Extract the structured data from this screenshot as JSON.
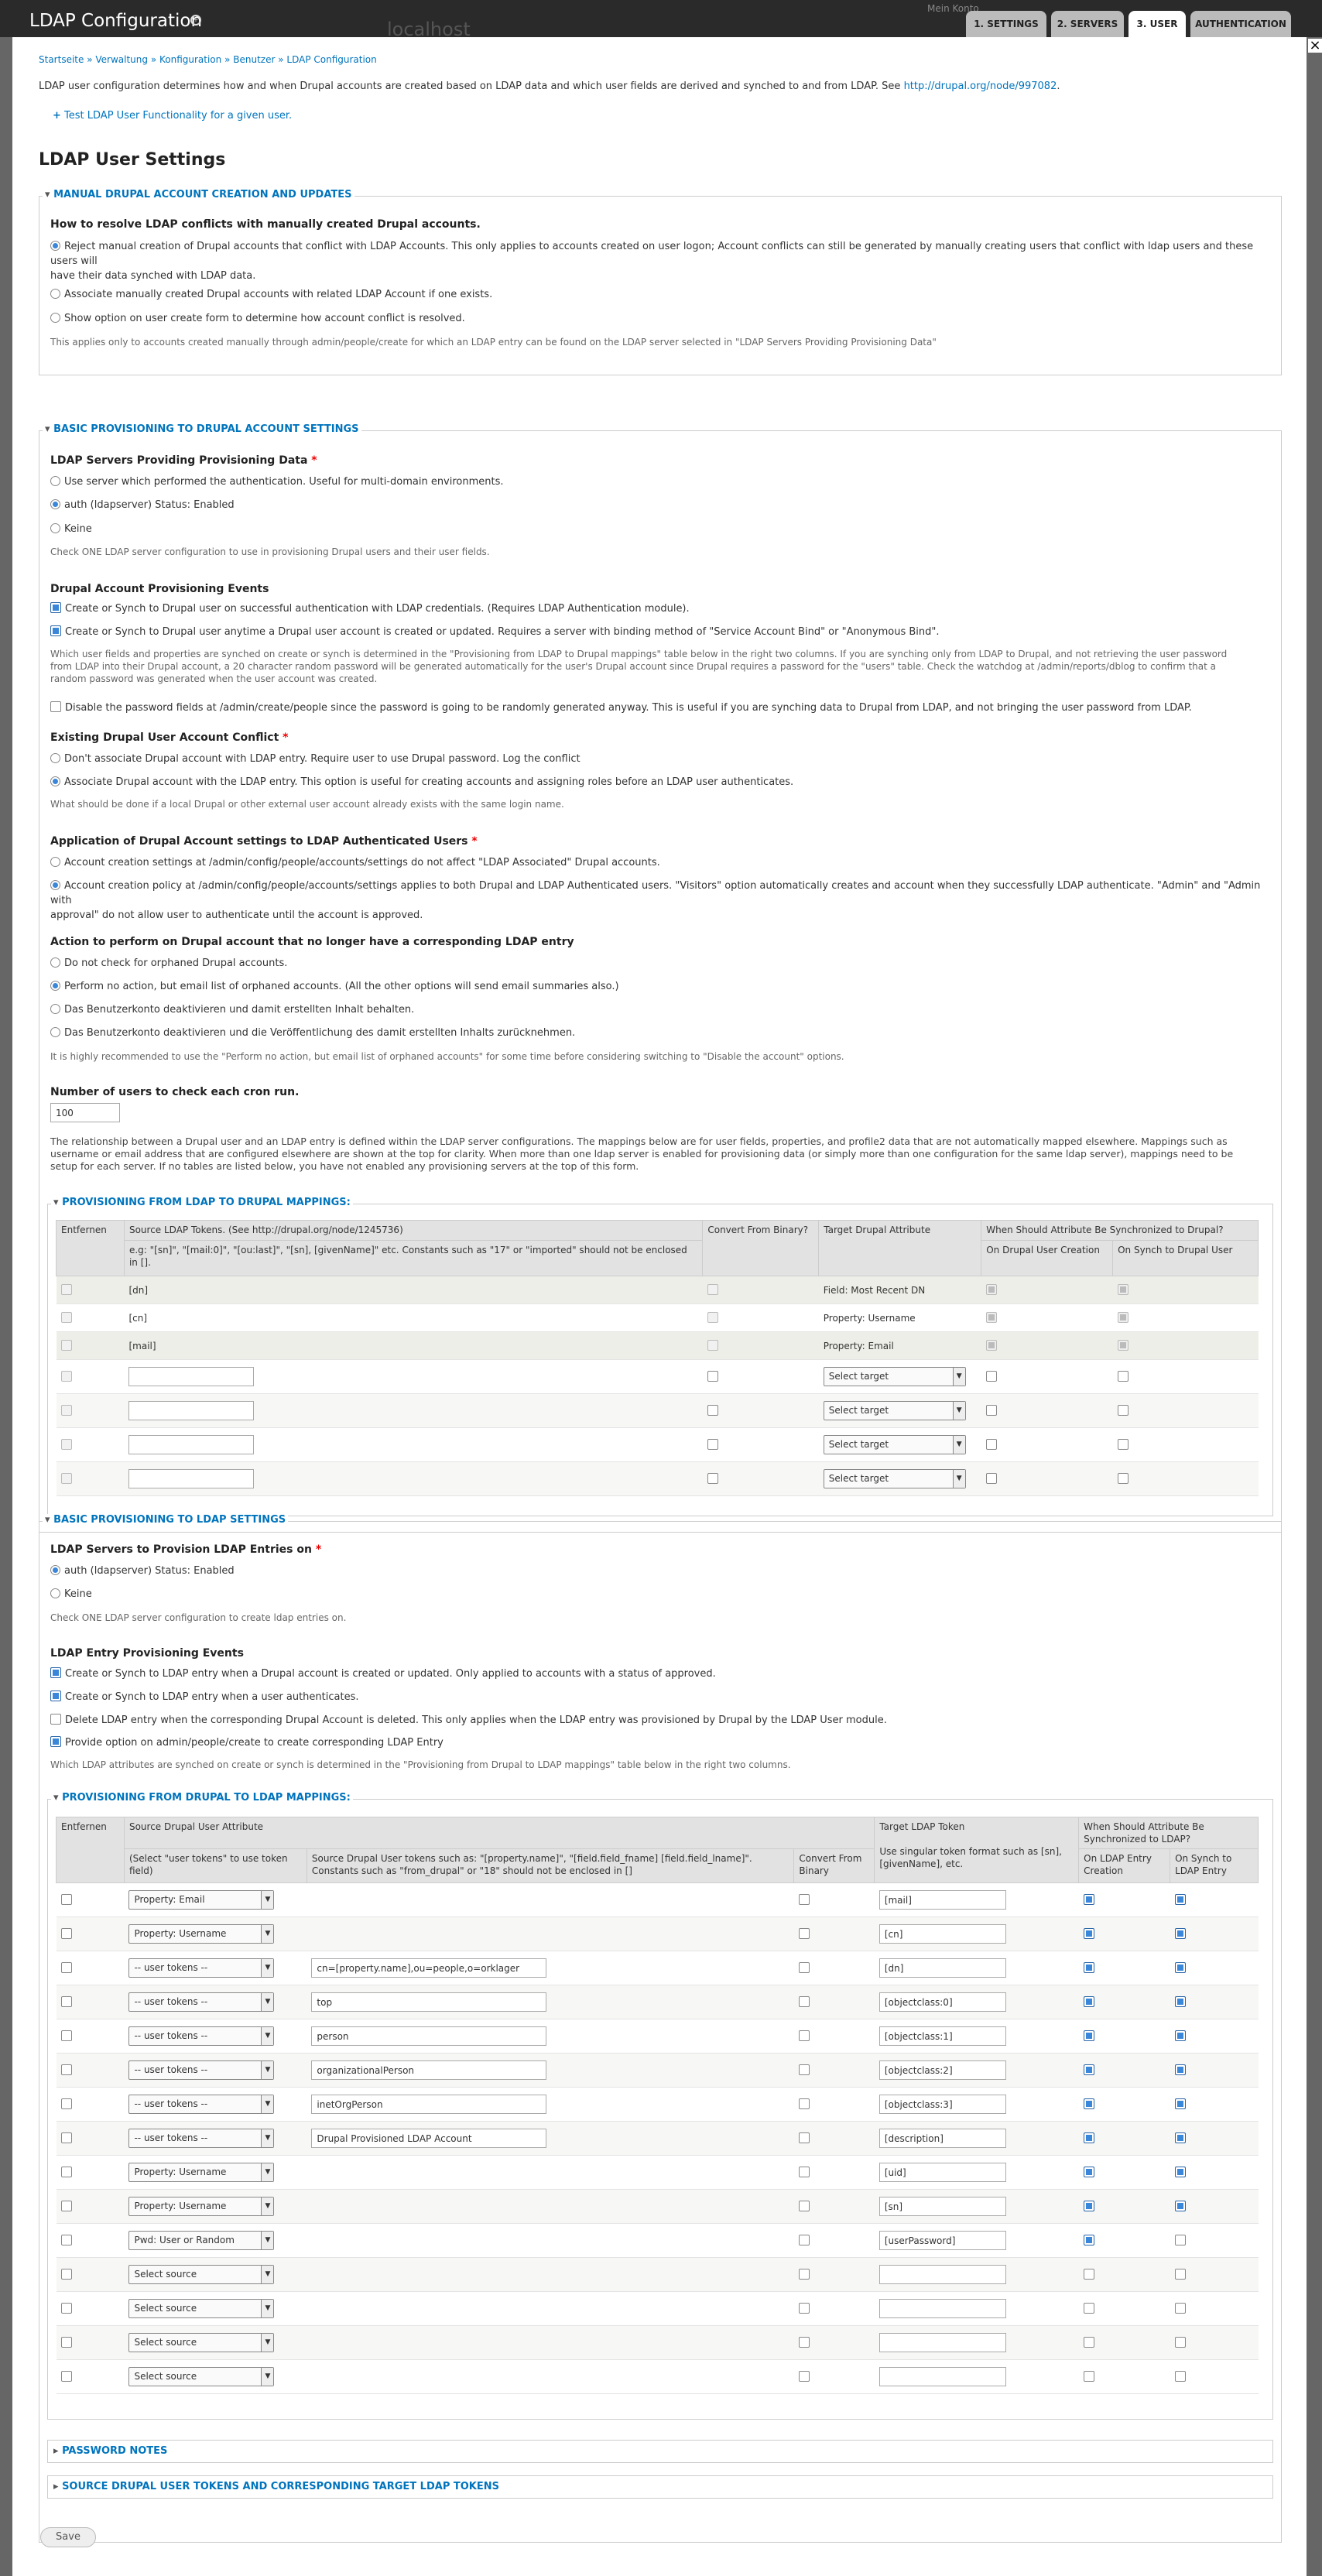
{
  "header": {
    "title": "LDAP Configuration",
    "site": "localhost",
    "user_link": "Mein Konto"
  },
  "tabs": [
    "1. SETTINGS",
    "2. SERVERS",
    "3. USER",
    "AUTHENTICATION"
  ],
  "breadcrumb": [
    "Startseite",
    "Verwaltung",
    "Konfiguration",
    "Benutzer",
    "LDAP Configuration"
  ],
  "intro_text": "LDAP user configuration determines how and when Drupal accounts are created based on LDAP data and which user fields are derived and synched to and from LDAP. See",
  "intro_link": "http://drupal.org/node/997082",
  "test_link": "Test LDAP User Functionality for a given user.",
  "page_title": "LDAP User Settings",
  "manual": {
    "legend": "MANUAL DRUPAL ACCOUNT CREATION AND UPDATES",
    "question": "How to resolve LDAP conflicts with manually created Drupal accounts.",
    "options": [
      "Reject manual creation of Drupal accounts that conflict with LDAP Accounts. This only applies to accounts created on user logon; Account conflicts can still be generated by manually creating users that conflict with ldap users and these users will",
      "have their data synched with LDAP data.",
      "Associate manually created Drupal accounts with related LDAP Account if one exists.",
      "Show option on user create form to determine how account conflict is resolved."
    ],
    "desc": "This applies only to accounts created manually through admin/people/create for which an LDAP entry can be found on the LDAP server selected in \"LDAP Servers Providing Provisioning Data\""
  },
  "basic_drupal": {
    "legend": "BASIC PROVISIONING TO DRUPAL ACCOUNT SETTINGS",
    "servers_label": "LDAP Servers Providing Provisioning Data",
    "server_opts": [
      "Use server which performed the authentication. Useful for multi-domain environments.",
      "auth (ldapserver) Status: Enabled",
      "Keine"
    ],
    "server_desc": "Check ONE LDAP server configuration to use in provisioning Drupal users and their user fields.",
    "events_label": "Drupal Account Provisioning Events",
    "event_opts": [
      "Create or Synch to Drupal user on successful authentication with LDAP credentials. (Requires LDAP Authentication module).",
      "Create or Synch to Drupal user anytime a Drupal user account is created or updated. Requires a server with binding method of \"Service Account Bind\" or \"Anonymous Bind\"."
    ],
    "events_desc": [
      "Which user fields and properties are synched on create or synch is determined in the \"Provisioning from LDAP to Drupal mappings\" table below in the right two columns. If you are synching only from LDAP to Drupal, and not retrieving the user password",
      "from LDAP into their Drupal account, a 20 character random password will be generated automatically for the user's Drupal account since Drupal requires a password for the \"users\" table. Check the watchdog at /admin/reports/dblog to confirm that a",
      "random password was generated when the user account was created."
    ],
    "disable_pw": "Disable the password fields at /admin/create/people since the password is going to be randomly generated anyway. This is useful if you are synching data to Drupal from LDAP, and not bringing the user password from LDAP.",
    "conflict_label": "Existing Drupal User Account Conflict",
    "conflict_opts": [
      "Don't associate Drupal account with LDAP entry. Require user to use Drupal password. Log the conflict",
      "Associate Drupal account with the LDAP entry. This option is useful for creating accounts and assigning roles before an LDAP user authenticates."
    ],
    "conflict_desc": "What should be done if a local Drupal or other external user account already exists with the same login name.",
    "app_label": "Application of Drupal Account settings to LDAP Authenticated Users",
    "app_opts": [
      "Account creation settings at /admin/config/people/accounts/settings do not affect \"LDAP Associated\" Drupal accounts.",
      "Account creation policy at /admin/config/people/accounts/settings applies to both Drupal and LDAP Authenticated users. \"Visitors\" option automatically creates and account when they successfully LDAP authenticate. \"Admin\" and \"Admin with",
      "approval\" do not allow user to authenticate until the account is approved."
    ],
    "orphan_label": "Action to perform on Drupal account that no longer have a corresponding LDAP entry",
    "orphan_opts": [
      "Do not check for orphaned Drupal accounts.",
      "Perform no action, but email list of orphaned accounts. (All the other options will send email summaries also.)",
      "Das Benutzerkonto deaktivieren und damit erstellten Inhalt behalten.",
      "Das Benutzerkonto deaktivieren und die Veröffentlichung des damit erstellten Inhalts zurücknehmen."
    ],
    "orphan_desc": "It is highly recommended to use the \"Perform no action, but email list of orphaned accounts\" for some time before considering switching to \"Disable the account\" options.",
    "cron_label": "Number of users to check each cron run.",
    "cron_value": "100",
    "mapping_desc": [
      "The relationship between a Drupal user and an LDAP entry is defined within the LDAP server configurations. The mappings below are for user fields, properties, and profile2 data that are not automatically mapped elsewhere. Mappings such as",
      "username or email address that are configured elsewhere are shown at the top for clarity. When more than one ldap server is enabled for provisioning data (or simply more than one configuration for the same ldap server), mappings need to be",
      "setup for each server. If no tables are listed below, you have not enabled any provisioning servers at the top of this form."
    ]
  },
  "ldap_to_drupal": {
    "legend": "PROVISIONING FROM LDAP TO DRUPAL MAPPINGS:",
    "headers": [
      "Entfernen",
      "Source LDAP Tokens. (See http://drupal.org/node/1245736)",
      "Convert From Binary?",
      "Target Drupal Attribute",
      "When Should Attribute Be Synchronized to Drupal?"
    ],
    "subheaders": [
      "e.g: \"[sn]\", \"[mail:0]\", \"[ou:last]\", \"[sn], [givenName]\" etc. Constants such as \"17\" or \"imported\" should not be enclosed",
      "in [].",
      "On Drupal User Creation",
      "On Synch to Drupal User"
    ],
    "fixed_rows": [
      {
        "source": "[dn]",
        "target": "Field: Most Recent DN"
      },
      {
        "source": "[cn]",
        "target": "Property: Username"
      },
      {
        "source": "[mail]",
        "target": "Property: Email"
      }
    ],
    "select_target": "Select target"
  },
  "basic_ldap": {
    "legend": "BASIC PROVISIONING TO LDAP SETTINGS",
    "servers_label": "LDAP Servers to Provision LDAP Entries on",
    "server_opts": [
      "auth (ldapserver) Status: Enabled",
      "Keine"
    ],
    "server_desc": "Check ONE LDAP server configuration to create ldap entries on.",
    "events_label": "LDAP Entry Provisioning Events",
    "event_opts": [
      "Create or Synch to LDAP entry when a Drupal account is created or updated. Only applied to accounts with a status of approved.",
      "Create or Synch to LDAP entry when a user authenticates.",
      "Delete LDAP entry when the corresponding Drupal Account is deleted. This only applies when the LDAP entry was provisioned by Drupal by the LDAP User module.",
      "Provide option on admin/people/create to create corresponding LDAP Entry"
    ],
    "events_desc": "Which LDAP attributes are synched on create or synch is determined in the \"Provisioning from Drupal to LDAP mappings\" table below in the right two columns."
  },
  "drupal_to_ldap": {
    "legend": "PROVISIONING FROM DRUPAL TO LDAP MAPPINGS:",
    "headers": [
      "Entfernen",
      "Source Drupal User Attribute",
      "Target LDAP Token",
      "When Should Attribute Be Synchronized to LDAP?"
    ],
    "subheaders": [
      "(Select \"user tokens\" to use token field)",
      "Source Drupal User tokens such as: \"[property.name]\", \"[field.field_fname] [field.field_lname]\". Constants such as \"from_drupal\" or \"18\" should not be enclosed in []",
      "Convert From Binary",
      "Use singular token format such as [sn], [givenName], etc.",
      "On LDAP Entry Creation",
      "On Synch to LDAP Entry"
    ],
    "rows": [
      {
        "source": "Property: Email",
        "token": "",
        "target": "[mail]",
        "create": true,
        "synch": true,
        "dim": false
      },
      {
        "source": "Property: Username",
        "token": "",
        "target": "[cn]",
        "create": true,
        "synch": true,
        "dim": false
      },
      {
        "source": "-- user tokens --",
        "token": "cn=[property.name],ou=people,o=orklager",
        "target": "[dn]",
        "create": true,
        "synch": true,
        "dim": false
      },
      {
        "source": "-- user tokens --",
        "token": "top",
        "target": "[objectclass:0]",
        "create": true,
        "synch": true,
        "dim": false
      },
      {
        "source": "-- user tokens --",
        "token": "person",
        "target": "[objectclass:1]",
        "create": true,
        "synch": true,
        "dim": false
      },
      {
        "source": "-- user tokens --",
        "token": "organizationalPerson",
        "target": "[objectclass:2]",
        "create": true,
        "synch": true,
        "dim": false
      },
      {
        "source": "-- user tokens --",
        "token": "inetOrgPerson",
        "target": "[objectclass:3]",
        "create": true,
        "synch": true,
        "dim": false
      },
      {
        "source": "-- user tokens --",
        "token": "Drupal Provisioned LDAP Account",
        "target": "[description]",
        "create": true,
        "synch": true,
        "dim": false
      },
      {
        "source": "Property: Username",
        "token": "",
        "target": "[uid]",
        "create": true,
        "synch": true,
        "dim": false
      },
      {
        "source": "Property: Username",
        "token": "",
        "target": "[sn]",
        "create": true,
        "synch": true,
        "dim": false
      },
      {
        "source": "Pwd: User or Random",
        "token": "",
        "target": "[userPassword]",
        "create": true,
        "synch": false,
        "dim": false
      },
      {
        "source": "Select source",
        "token": "",
        "target": "",
        "create": false,
        "synch": false,
        "dim": true
      },
      {
        "source": "Select source",
        "token": "",
        "target": "",
        "create": false,
        "synch": false,
        "dim": true
      },
      {
        "source": "Select source",
        "token": "",
        "target": "",
        "create": false,
        "synch": false,
        "dim": true
      },
      {
        "source": "Select source",
        "token": "",
        "target": "",
        "create": false,
        "synch": false,
        "dim": true
      }
    ]
  },
  "password_notes": "PASSWORD NOTES",
  "source_tokens": "SOURCE DRUPAL USER TOKENS AND CORRESPONDING TARGET LDAP TOKENS",
  "save": "Save",
  "colors": {
    "accent": "#0074bd",
    "toolbar": "#2a2a2a",
    "checked": "#3a86d8"
  }
}
